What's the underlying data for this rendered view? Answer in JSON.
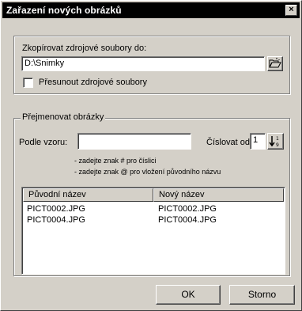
{
  "window": {
    "title": "Zařazení nových obrázků",
    "close_glyph": "×"
  },
  "copy_section": {
    "label": "Zkopírovat zdrojové soubory do:",
    "path_value": "D:\\Snimky",
    "browse_icon": "folder-open-icon",
    "move_checkbox_label": "Přesunout zdrojové soubory",
    "move_checked": false
  },
  "rename_section": {
    "legend": "Přejmenovat obrázky",
    "pattern_label": "Podle vzoru:",
    "pattern_value": "",
    "number_from_label": "Číslovat od:",
    "number_from_value": "1",
    "hint1": "- zadejte znak # pro číslici",
    "hint2": "- zadejte znak @ pro vložení původního názvu",
    "columns": {
      "original": "Původní název",
      "new": "Nový název"
    },
    "rows": [
      {
        "original": "PICT0002.JPG",
        "new": "PICT0002.JPG"
      },
      {
        "original": "PICT0004.JPG",
        "new": "PICT0004.JPG"
      }
    ]
  },
  "buttons": {
    "ok": "OK",
    "cancel": "Storno"
  }
}
